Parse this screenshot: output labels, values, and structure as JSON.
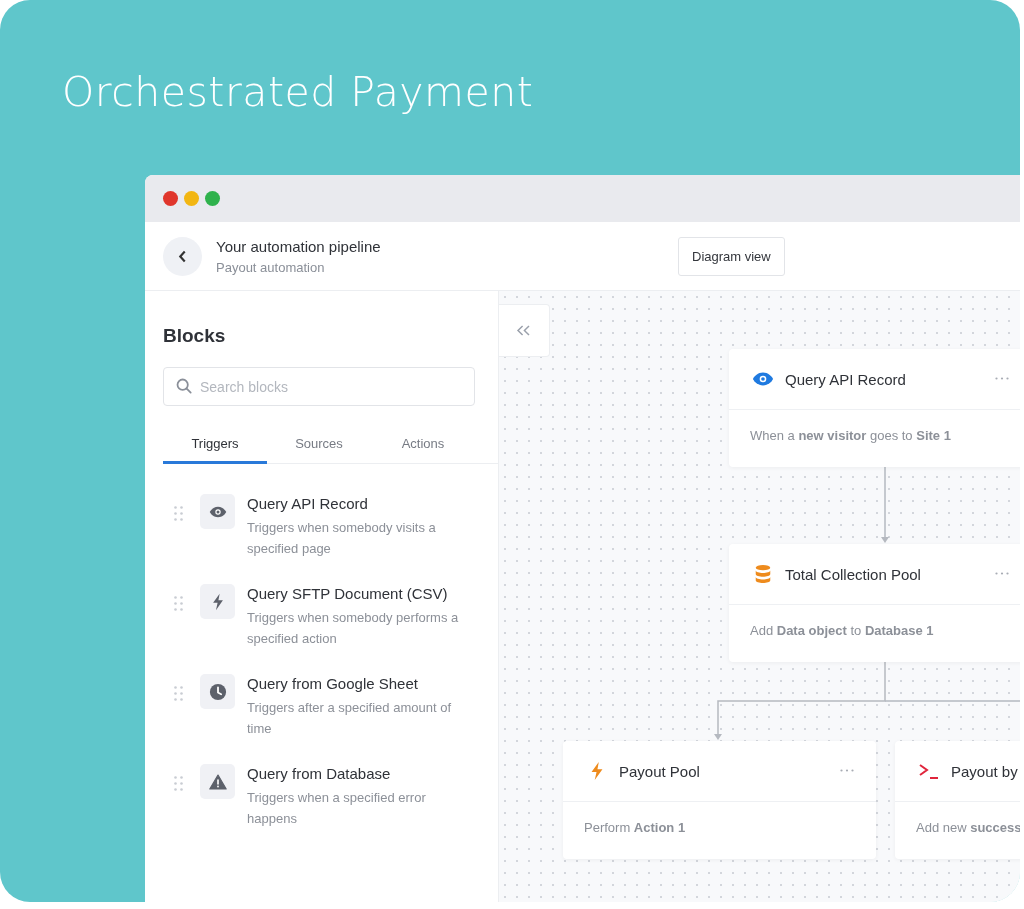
{
  "title": "Orchestrated Payment",
  "header": {
    "title": "Your automation pipeline",
    "subtitle": "Payout automation",
    "view_button": "Diagram view"
  },
  "sidebar": {
    "heading": "Blocks",
    "search": {
      "placeholder": "Search blocks"
    },
    "tabs": [
      {
        "label": "Triggers",
        "selected": true
      },
      {
        "label": "Sources",
        "selected": false
      },
      {
        "label": "Actions",
        "selected": false
      }
    ],
    "blocks": [
      {
        "kind": "eye",
        "title": "Query API Record",
        "description": "Triggers when somebody visits a specified page"
      },
      {
        "kind": "bolt",
        "title": "Query SFTP Document (CSV)",
        "description": "Triggers when somebody performs a specified action"
      },
      {
        "kind": "clock",
        "title": "Query from Google Sheet",
        "description": "Triggers after a specified amount of time"
      },
      {
        "kind": "warning",
        "title": "Query from Database",
        "description": "Triggers when a specified error happens"
      }
    ]
  },
  "canvas": {
    "nodes": [
      {
        "kind": "eye",
        "title": "Query API Record",
        "description": "When a **new visitor** goes to **Site 1**",
        "menu": true
      },
      {
        "kind": "database",
        "title": "Total Collection Pool",
        "description": "Add **Data object** to **Database 1**",
        "menu": true
      },
      {
        "kind": "bolt",
        "title": "Payout Pool",
        "description": "Perform **Action 1**",
        "menu": true
      },
      {
        "kind": "terminal",
        "title": "Payout by",
        "description": "Add new **success**",
        "menu": false
      }
    ]
  }
}
